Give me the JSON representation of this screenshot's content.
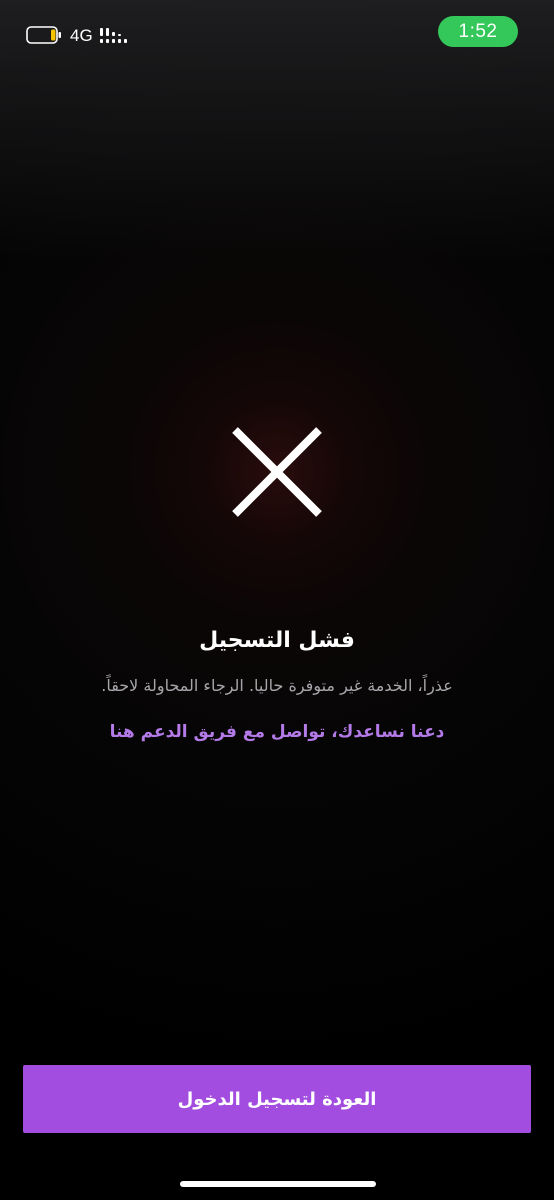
{
  "status_bar": {
    "network": "4G",
    "time": "1:52",
    "battery_icon": "battery-low-icon",
    "signal_icon": "signal-bars-icon",
    "time_pill_color": "#34c759",
    "battery_fill_color": "#f5c400"
  },
  "result": {
    "icon": "close-x-icon",
    "title": "فشل التسجيل",
    "message": "عذراً، الخدمة غير متوفرة حاليا. الرجاء المحاولة لاحقاً.",
    "support_link": "دعنا نساعدك، تواصل مع فريق الدعم هنا"
  },
  "footer": {
    "back_to_login_label": "العودة لتسجيل الدخول",
    "button_color": "#a24ddf",
    "link_color": "#b37ae8"
  }
}
